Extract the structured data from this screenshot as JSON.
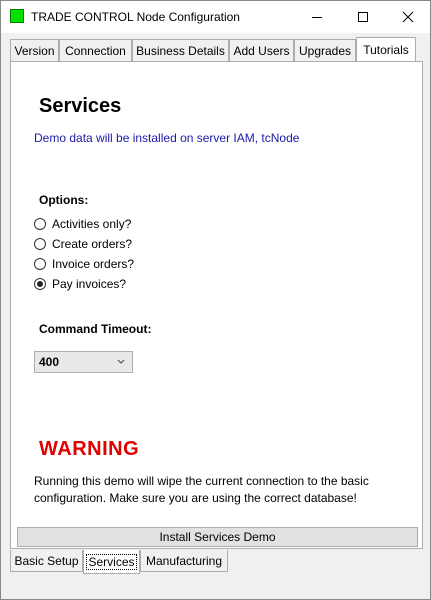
{
  "window": {
    "title": "TRADE CONTROL Node Configuration",
    "icon": "app-icon-green",
    "accent_color": "#00e000"
  },
  "top_tabs": [
    {
      "label": "Version",
      "active": false
    },
    {
      "label": "Connection",
      "active": false
    },
    {
      "label": "Business Details",
      "active": false
    },
    {
      "label": "Add Users",
      "active": false
    },
    {
      "label": "Upgrades",
      "active": false
    },
    {
      "label": "Tutorials",
      "active": true
    }
  ],
  "services": {
    "heading": "Services",
    "info": "Demo data will be installed on server IAM, tcNode",
    "info_color": "#1a1aa6",
    "options_label": "Options:",
    "options": [
      {
        "label": "Activities only?",
        "selected": false
      },
      {
        "label": "Create orders?",
        "selected": false
      },
      {
        "label": "Invoice orders?",
        "selected": false
      },
      {
        "label": "Pay invoices?",
        "selected": true
      }
    ],
    "timeout_label": "Command Timeout:",
    "timeout_value": "400",
    "warning_title": "WARNING",
    "warning_color": "#e00000",
    "warning_text": "Running this demo will wipe the current connection to the basic configuration. Make sure you are using the correct database!",
    "install_button": "Install Services Demo"
  },
  "bottom_tabs": [
    {
      "label": "Basic Setup",
      "active": false
    },
    {
      "label": "Services",
      "active": true
    },
    {
      "label": "Manufacturing",
      "active": false
    }
  ]
}
